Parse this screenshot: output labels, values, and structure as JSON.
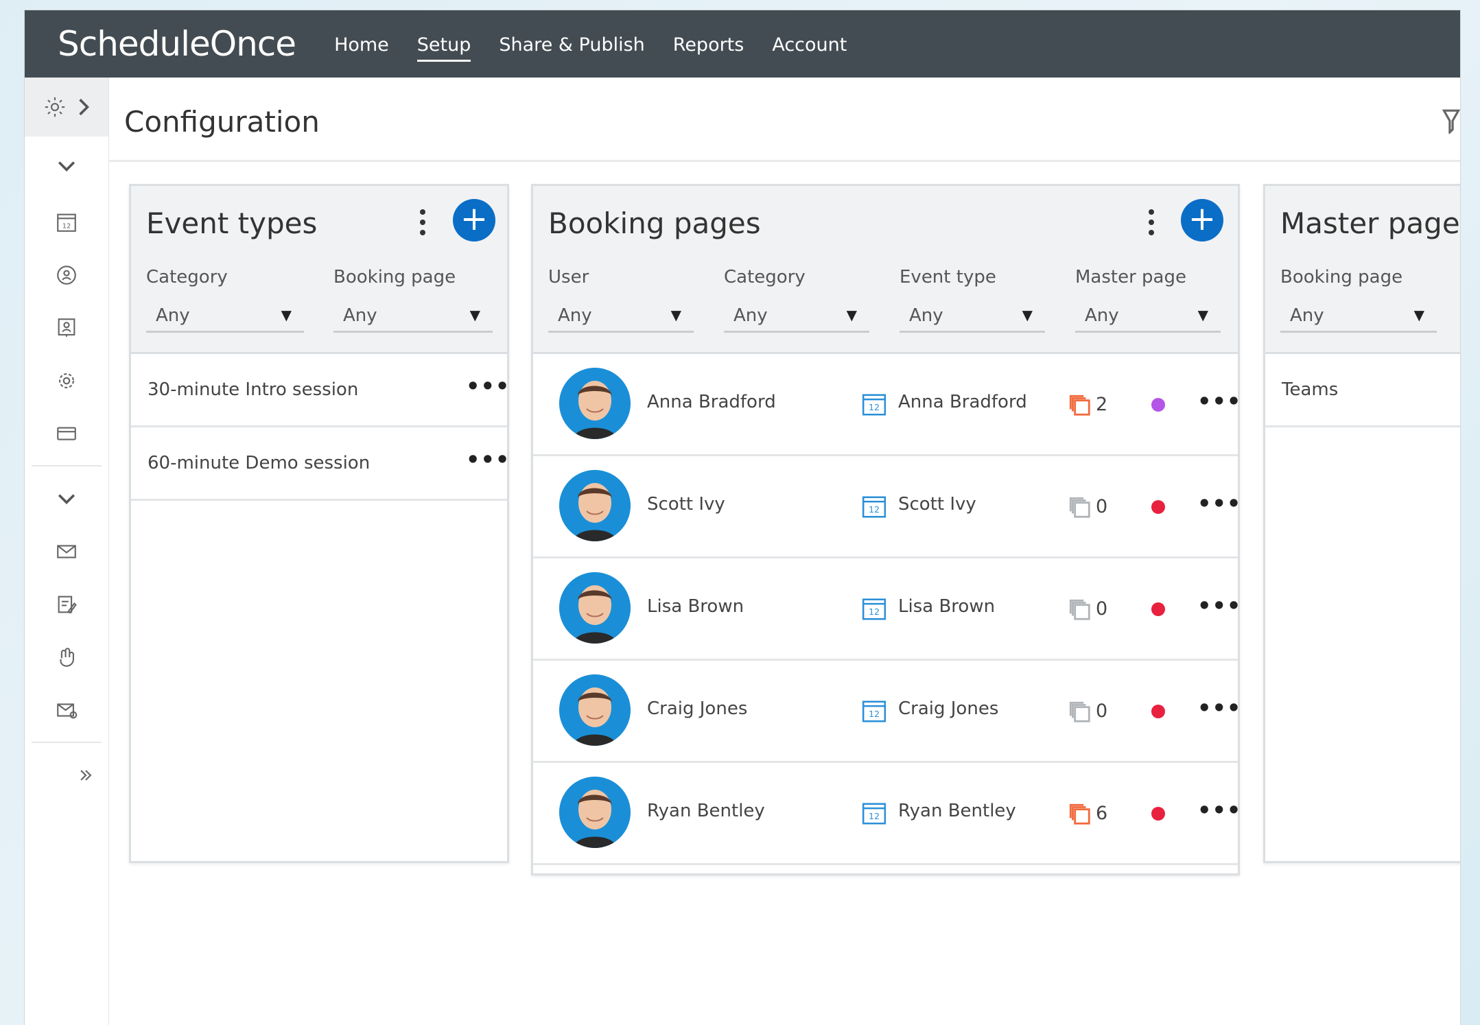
{
  "app": {
    "logo": "ScheduleOnce",
    "nav": [
      "Home",
      "Setup",
      "Share & Publish",
      "Reports",
      "Account"
    ],
    "active_nav": "Setup"
  },
  "page": {
    "title": "Configuration"
  },
  "event_types": {
    "title": "Event types",
    "filters": [
      {
        "label": "Category",
        "value": "Any"
      },
      {
        "label": "Booking page",
        "value": "Any"
      }
    ],
    "items": [
      "30-minute Intro session",
      "60-minute Demo session"
    ]
  },
  "booking_pages": {
    "title": "Booking pages",
    "filters": [
      {
        "label": "User",
        "value": "Any"
      },
      {
        "label": "Category",
        "value": "Any"
      },
      {
        "label": "Event type",
        "value": "Any"
      },
      {
        "label": "Master page",
        "value": "Any"
      }
    ],
    "rows": [
      {
        "user": "Anna Bradford",
        "page": "Anna Bradford",
        "count": "2",
        "count_color": "#f26a3d",
        "status_color": "#b455e8"
      },
      {
        "user": "Scott Ivy",
        "page": "Scott Ivy",
        "count": "0",
        "count_color": "#b0b4b8",
        "status_color": "#e8213f"
      },
      {
        "user": "Lisa Brown",
        "page": "Lisa Brown",
        "count": "0",
        "count_color": "#b0b4b8",
        "status_color": "#e8213f"
      },
      {
        "user": "Craig Jones",
        "page": "Craig Jones",
        "count": "0",
        "count_color": "#b0b4b8",
        "status_color": "#e8213f"
      },
      {
        "user": "Ryan Bentley",
        "page": "Ryan Bentley",
        "count": "6",
        "count_color": "#f26a3d",
        "status_color": "#e8213f"
      }
    ]
  },
  "master_pages": {
    "title": "Master pages",
    "filters": [
      {
        "label": "Booking page",
        "value": "Any"
      }
    ],
    "items": [
      "Teams"
    ]
  },
  "colors": {
    "topbar": "#434c52",
    "accent": "#0a6ec7",
    "avatar_bg": "#1a8fd8"
  },
  "icons": {
    "sidebar": [
      "gear-icon",
      "chevron-right-icon",
      "chevron-down-icon",
      "calendar-icon",
      "user-clock-icon",
      "presenter-icon",
      "settings-icon",
      "card-icon",
      "chevron-down-icon",
      "mail-icon",
      "form-edit-icon",
      "hand-icon",
      "mail-settings-icon",
      "double-chevron-right-icon"
    ]
  }
}
